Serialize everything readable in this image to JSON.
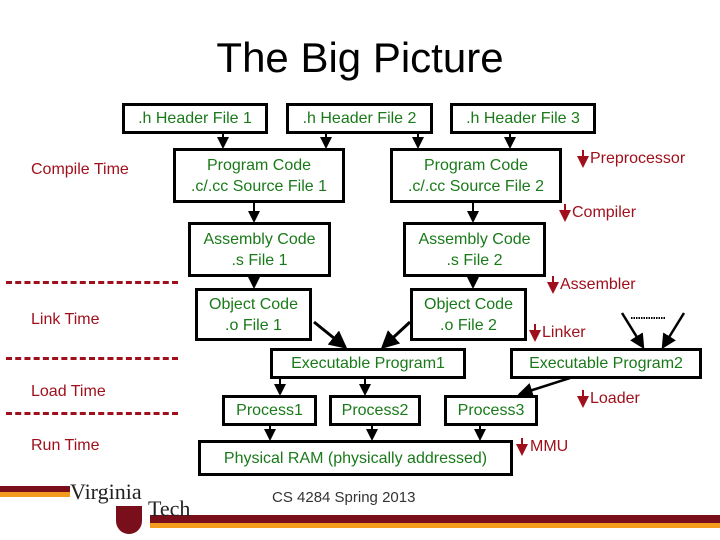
{
  "title": "The Big Picture",
  "stages": [
    "Compile Time",
    "Link Time",
    "Load Time",
    "Run Time"
  ],
  "boxes": {
    "header1": ".h Header File 1",
    "header2": ".h Header File 2",
    "header3": ".h Header File 3",
    "program1": [
      "Program Code",
      ".c/.cc Source File 1"
    ],
    "program2": [
      "Program Code",
      ".c/.cc Source File 2"
    ],
    "assembly1": [
      "Assembly Code",
      ".s File 1"
    ],
    "assembly2": [
      "Assembly Code",
      ".s File 2"
    ],
    "object1": [
      "Object Code",
      ".o File 1"
    ],
    "object2": [
      "Object Code",
      ".o File 2"
    ],
    "exec1": "Executable Program1",
    "exec2": "Executable Program2",
    "process1": "Process1",
    "process2": "Process2",
    "process3": "Process3",
    "ram": "Physical RAM (physically addressed)"
  },
  "tools": [
    "Preprocessor",
    "Compiler",
    "Assembler",
    "Linker",
    "Loader",
    "MMU"
  ],
  "footer": "CS 4284 Spring 2013",
  "logo": "Virginia Tech",
  "colors": {
    "box_text": "#1a7a1a",
    "annotation": "#a0101c",
    "orange": "#f29b1d"
  }
}
